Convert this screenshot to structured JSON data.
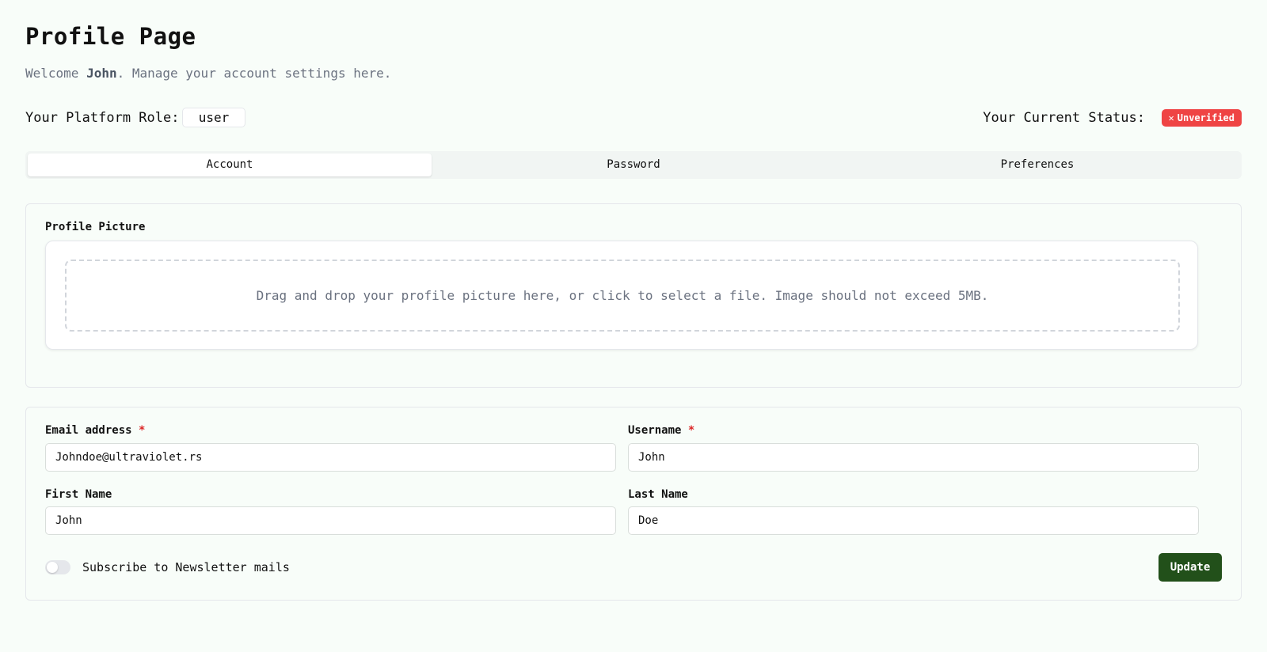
{
  "header": {
    "title": "Profile Page",
    "welcome_prefix": "Welcome ",
    "welcome_name": "John",
    "welcome_suffix": ". Manage your account settings here."
  },
  "role": {
    "label": "Your Platform Role:",
    "value": "user"
  },
  "status": {
    "label": "Your Current Status:",
    "icon": "x-icon",
    "icon_glyph": "✕",
    "value": "Unverified",
    "color": "#ef4444"
  },
  "tabs": [
    {
      "label": "Account",
      "active": true
    },
    {
      "label": "Password",
      "active": false
    },
    {
      "label": "Preferences",
      "active": false
    }
  ],
  "profile_picture": {
    "label": "Profile Picture",
    "dropzone_text": "Drag and drop your profile picture here, or click to select a file. Image should not exceed 5MB."
  },
  "form": {
    "email": {
      "label": "Email address",
      "required_mark": "*",
      "value": "Johndoe@ultraviolet.rs"
    },
    "username": {
      "label": "Username",
      "required_mark": "*",
      "value": "John"
    },
    "first_name": {
      "label": "First Name",
      "value": "John"
    },
    "last_name": {
      "label": "Last Name",
      "value": "Doe"
    },
    "newsletter": {
      "label": "Subscribe to Newsletter mails",
      "checked": false
    },
    "update_label": "Update"
  },
  "colors": {
    "background": "#f8fdf9",
    "accent": "#22501a",
    "danger": "#ef4444",
    "required": "#dc2626"
  }
}
